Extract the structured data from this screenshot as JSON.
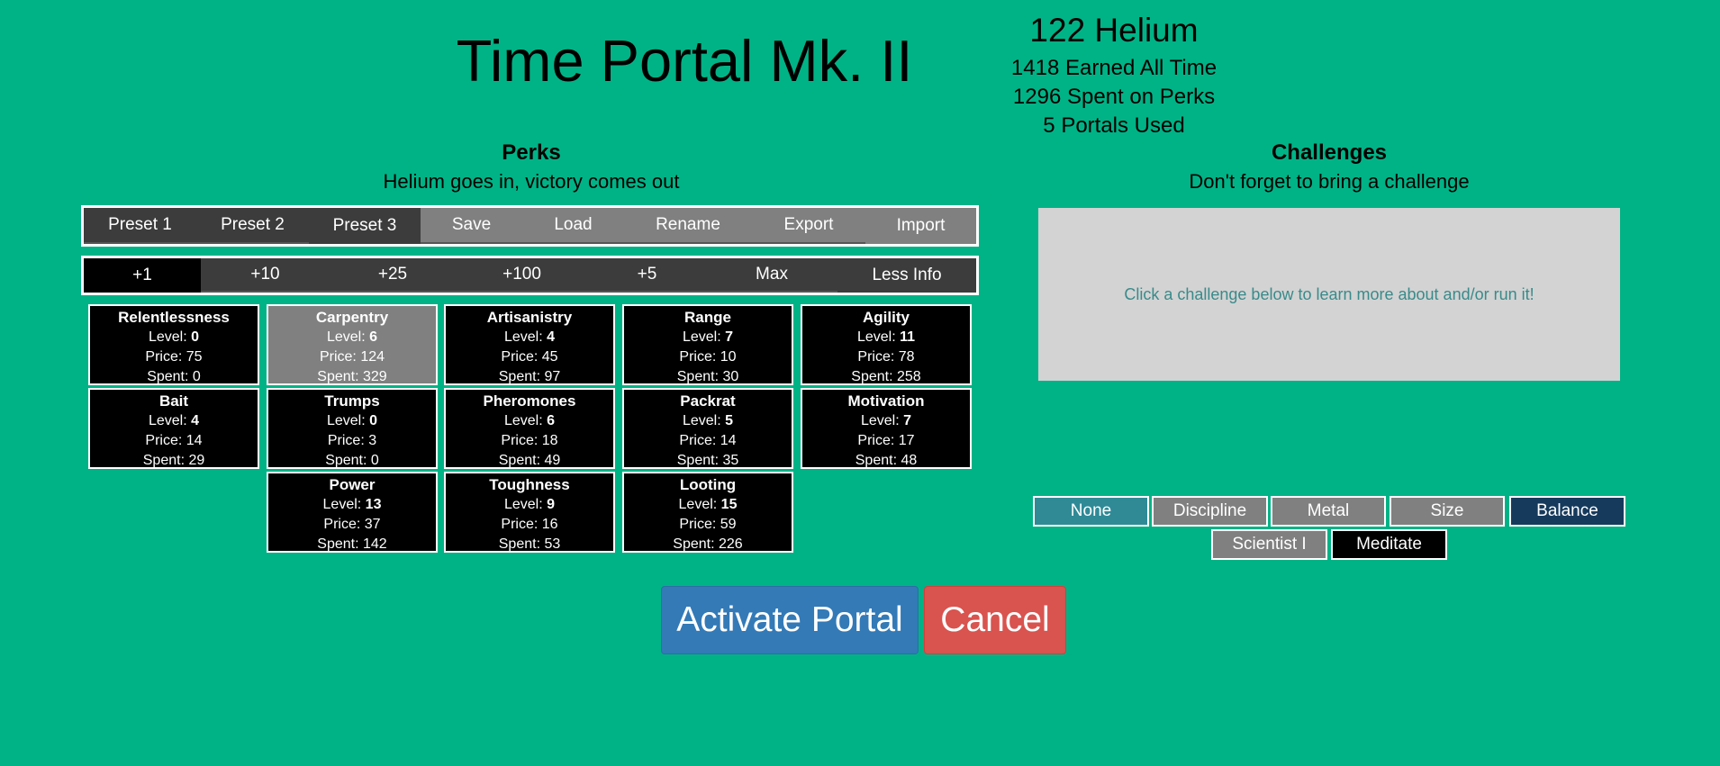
{
  "header": {
    "title": "Time Portal Mk. II",
    "helium": "122 Helium",
    "earned": "1418 Earned All Time",
    "spent": "1296 Spent on Perks",
    "portals": "5 Portals Used"
  },
  "perks_section": {
    "heading": "Perks",
    "subtitle": "Helium goes in, victory comes out",
    "preset_bar": [
      {
        "label": "Preset 1"
      },
      {
        "label": "Preset 2"
      },
      {
        "label": "Preset 3"
      },
      {
        "label": "Save"
      },
      {
        "label": "Load"
      },
      {
        "label": "Rename"
      },
      {
        "label": "Export"
      },
      {
        "label": "Import"
      }
    ],
    "amount_bar": [
      {
        "label": "+1"
      },
      {
        "label": "+10"
      },
      {
        "label": "+25"
      },
      {
        "label": "+100"
      },
      {
        "label": "+5"
      },
      {
        "label": "Max"
      },
      {
        "label": "Less Info"
      }
    ],
    "level_label": "Level: ",
    "price_label": "Price: ",
    "spent_label": "Spent: ",
    "perks": [
      {
        "name": "Relentlessness",
        "level": "0",
        "price": "75",
        "spent": "0"
      },
      {
        "name": "Carpentry",
        "level": "6",
        "price": "124",
        "spent": "329"
      },
      {
        "name": "Artisanistry",
        "level": "4",
        "price": "45",
        "spent": "97"
      },
      {
        "name": "Range",
        "level": "7",
        "price": "10",
        "spent": "30"
      },
      {
        "name": "Agility",
        "level": "11",
        "price": "78",
        "spent": "258"
      },
      {
        "name": "Bait",
        "level": "4",
        "price": "14",
        "spent": "29"
      },
      {
        "name": "Trumps",
        "level": "0",
        "price": "3",
        "spent": "0"
      },
      {
        "name": "Pheromones",
        "level": "6",
        "price": "18",
        "spent": "49"
      },
      {
        "name": "Packrat",
        "level": "5",
        "price": "14",
        "spent": "35"
      },
      {
        "name": "Motivation",
        "level": "7",
        "price": "17",
        "spent": "48"
      },
      {
        "name": "Power",
        "level": "13",
        "price": "37",
        "spent": "142"
      },
      {
        "name": "Toughness",
        "level": "9",
        "price": "16",
        "spent": "53"
      },
      {
        "name": "Looting",
        "level": "15",
        "price": "59",
        "spent": "226"
      }
    ]
  },
  "challenges_section": {
    "heading": "Challenges",
    "subtitle": "Don't forget to bring a challenge",
    "info": "Click a challenge below to learn more about and/or run it!",
    "buttons": [
      {
        "label": "None"
      },
      {
        "label": "Discipline"
      },
      {
        "label": "Metal"
      },
      {
        "label": "Size"
      },
      {
        "label": "Balance"
      },
      {
        "label": "Scientist I"
      },
      {
        "label": "Meditate"
      }
    ]
  },
  "portal_buttons": {
    "activate": "Activate Portal",
    "cancel": "Cancel"
  },
  "colors": {
    "background": "#00B386",
    "perk_bg": "#000000",
    "perk_selected": "#808080",
    "activate": "#337ab7",
    "cancel": "#d9534f",
    "balance": "#163a5c",
    "none_challenge": "#2f8a96"
  }
}
